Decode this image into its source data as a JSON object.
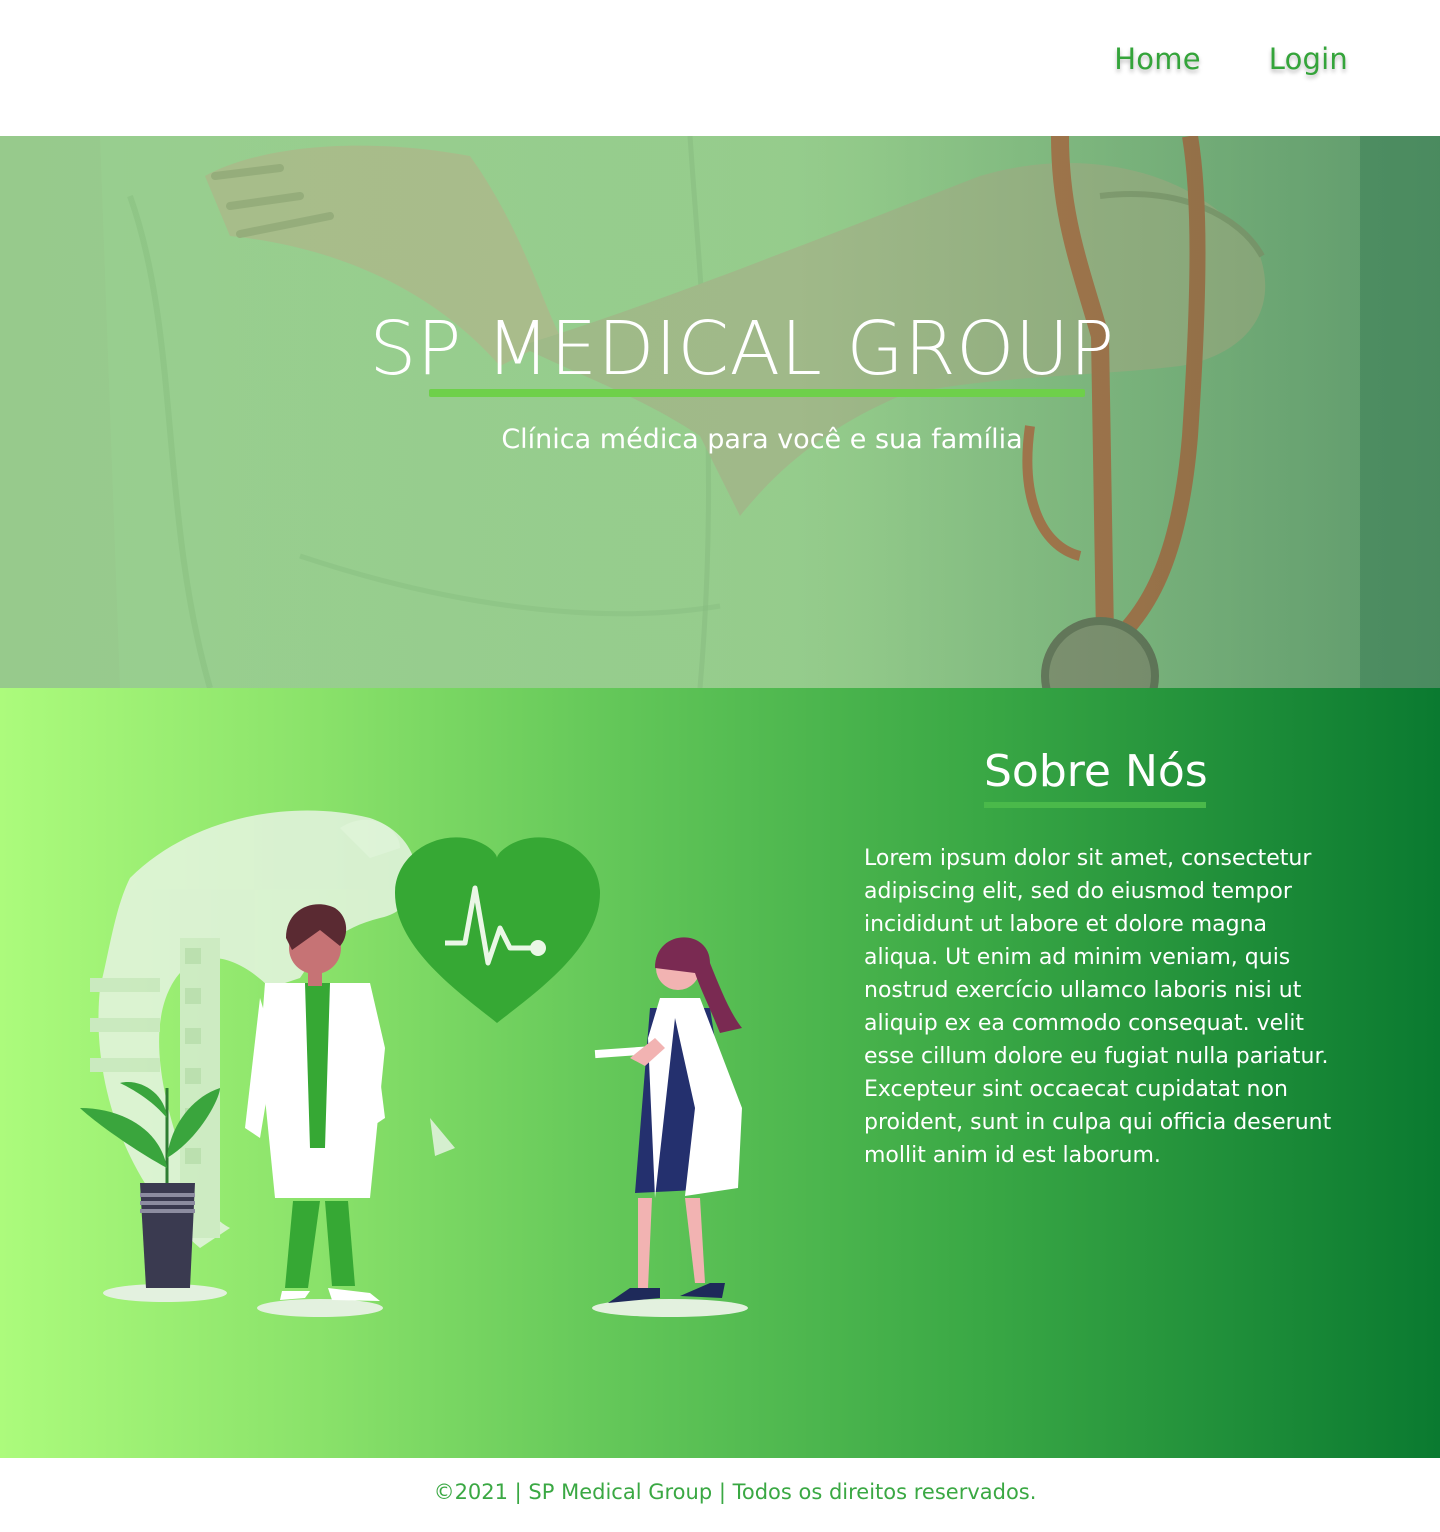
{
  "nav": {
    "home": "Home",
    "login": "Login"
  },
  "hero": {
    "title": "SP MEDICAL GROUP",
    "subtitle": "Clínica médica para você e sua família"
  },
  "about": {
    "title": "Sobre Nós",
    "body": "Lorem ipsum dolor sit amet, consectetur adipiscing elit, sed do eiusmod tempor incididunt ut labore et dolore magna aliqua. Ut enim ad minim veniam, quis nostrud exercício ullamco laboris nisi ut aliquip ex ea commodo consequat. velit esse cillum dolore eu fugiat nulla pariatur. Excepteur sint occaecat cupidatat non proident, sunt in culpa qui officia deserunt mollit anim id est laborum."
  },
  "footer": {
    "text": "©2021 | SP Medical Group | Todos os direitos reservados."
  },
  "colors": {
    "brand_green": "#34a43a",
    "accent_green": "#6ed04a",
    "dark_green": "#0a7a30",
    "light_green": "#acfb7c"
  }
}
